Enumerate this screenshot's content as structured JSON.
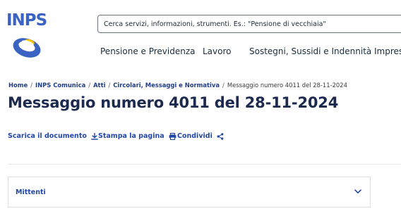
{
  "header": {
    "logo_text": "INPS",
    "search_placeholder": "Cerca servizi, informazioni, strumenti. Es.: \"Pensione di vecchiaia\"",
    "nav": [
      {
        "label": "Pensione e Previdenza"
      },
      {
        "label": "Lavoro"
      },
      {
        "label": "Sostegni, Sussidi e Indennità"
      },
      {
        "label": "Imprese"
      }
    ]
  },
  "breadcrumb": {
    "items": [
      {
        "label": "Home"
      },
      {
        "label": "INPS Comunica"
      },
      {
        "label": "Atti"
      },
      {
        "label": "Circolari, Messaggi e Normativa"
      },
      {
        "label": "Messaggio numero 4011 del 28-11-2024"
      }
    ],
    "separator": "/"
  },
  "page_title": "Messaggio numero 4011 del 28-11-2024",
  "actions": {
    "download": "Scarica il documento",
    "print": "Stampa la pagina",
    "share": "Condividi"
  },
  "accordion": {
    "label": "Mittenti"
  },
  "colors": {
    "brand_blue": "#3b63c4",
    "link_blue": "#2347a8",
    "title_navy": "#1b2a4e"
  },
  "icons": {
    "download": "download-icon",
    "print": "printer-icon",
    "share": "share-icon",
    "chevron": "chevron-down-icon",
    "logo_mark": "inps-ring-logo-icon"
  }
}
